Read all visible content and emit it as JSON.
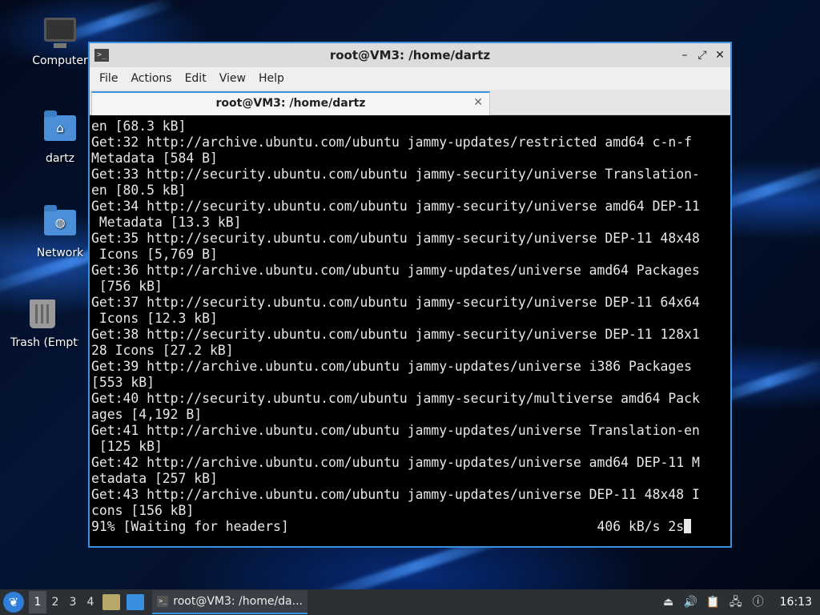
{
  "desktop": {
    "icons": [
      {
        "label": "Computer",
        "icon": "computer-icon"
      },
      {
        "label": "dartz",
        "icon": "home-folder-icon"
      },
      {
        "label": "Network",
        "icon": "network-folder-icon"
      },
      {
        "label": "Trash (Empty)",
        "icon": "trash-icon"
      }
    ]
  },
  "window": {
    "title": "root@VM3: /home/dartz",
    "app_icon": "terminal-icon",
    "controls": {
      "minimize": "–",
      "maximize": "⤢",
      "close": "✕"
    },
    "menu": [
      "File",
      "Actions",
      "Edit",
      "View",
      "Help"
    ],
    "tab": {
      "label": "root@VM3: /home/dartz",
      "close": "✕"
    },
    "lines": [
      "en [68.3 kB]",
      "Get:32 http://archive.ubuntu.com/ubuntu jammy-updates/restricted amd64 c-n-f",
      "Metadata [584 B]",
      "Get:33 http://security.ubuntu.com/ubuntu jammy-security/universe Translation-",
      "en [80.5 kB]",
      "Get:34 http://security.ubuntu.com/ubuntu jammy-security/universe amd64 DEP-11",
      " Metadata [13.3 kB]",
      "Get:35 http://security.ubuntu.com/ubuntu jammy-security/universe DEP-11 48x48",
      " Icons [5,769 B]",
      "Get:36 http://archive.ubuntu.com/ubuntu jammy-updates/universe amd64 Packages",
      " [756 kB]",
      "Get:37 http://security.ubuntu.com/ubuntu jammy-security/universe DEP-11 64x64",
      " Icons [12.3 kB]",
      "Get:38 http://security.ubuntu.com/ubuntu jammy-security/universe DEP-11 128x1",
      "28 Icons [27.2 kB]",
      "Get:39 http://archive.ubuntu.com/ubuntu jammy-updates/universe i386 Packages",
      "[553 kB]",
      "Get:40 http://security.ubuntu.com/ubuntu jammy-security/multiverse amd64 Pack",
      "ages [4,192 B]",
      "Get:41 http://archive.ubuntu.com/ubuntu jammy-updates/universe Translation-en",
      " [125 kB]",
      "Get:42 http://archive.ubuntu.com/ubuntu jammy-updates/universe amd64 DEP-11 M",
      "etadata [257 kB]",
      "Get:43 http://archive.ubuntu.com/ubuntu jammy-updates/universe DEP-11 48x48 I",
      "cons [156 kB]",
      "91% [Waiting for headers]                                       406 kB/s 2s"
    ]
  },
  "taskbar": {
    "start_icon": "lxqt-start-icon",
    "workspaces": [
      "1",
      "2",
      "3",
      "4"
    ],
    "active_workspace": "1",
    "task_label": "root@VM3: /home/da...",
    "clock": "16:13",
    "accent": "#3b8fe0"
  }
}
